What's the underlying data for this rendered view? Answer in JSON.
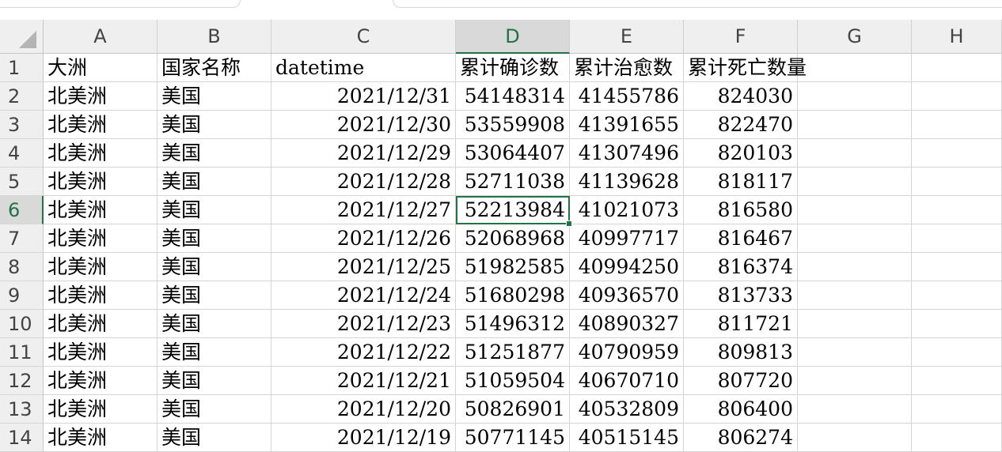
{
  "columns": [
    "A",
    "B",
    "C",
    "D",
    "E",
    "F",
    "G",
    "H"
  ],
  "selected_column": "D",
  "selected_row": "6",
  "header_row": {
    "row_number": "1",
    "cells": [
      "大洲",
      "国家名称",
      "datetime",
      "累计确诊数",
      "累计治愈数",
      "累计死亡数量"
    ]
  },
  "rows": [
    {
      "n": "2",
      "continent": "北美洲",
      "country": "美国",
      "date": "2021/12/31",
      "confirmed": "54148314",
      "recovered": "41455786",
      "deaths": "824030"
    },
    {
      "n": "3",
      "continent": "北美洲",
      "country": "美国",
      "date": "2021/12/30",
      "confirmed": "53559908",
      "recovered": "41391655",
      "deaths": "822470"
    },
    {
      "n": "4",
      "continent": "北美洲",
      "country": "美国",
      "date": "2021/12/29",
      "confirmed": "53064407",
      "recovered": "41307496",
      "deaths": "820103"
    },
    {
      "n": "5",
      "continent": "北美洲",
      "country": "美国",
      "date": "2021/12/28",
      "confirmed": "52711038",
      "recovered": "41139628",
      "deaths": "818117"
    },
    {
      "n": "6",
      "continent": "北美洲",
      "country": "美国",
      "date": "2021/12/27",
      "confirmed": "52213984",
      "recovered": "41021073",
      "deaths": "816580"
    },
    {
      "n": "7",
      "continent": "北美洲",
      "country": "美国",
      "date": "2021/12/26",
      "confirmed": "52068968",
      "recovered": "40997717",
      "deaths": "816467"
    },
    {
      "n": "8",
      "continent": "北美洲",
      "country": "美国",
      "date": "2021/12/25",
      "confirmed": "51982585",
      "recovered": "40994250",
      "deaths": "816374"
    },
    {
      "n": "9",
      "continent": "北美洲",
      "country": "美国",
      "date": "2021/12/24",
      "confirmed": "51680298",
      "recovered": "40936570",
      "deaths": "813733"
    },
    {
      "n": "10",
      "continent": "北美洲",
      "country": "美国",
      "date": "2021/12/23",
      "confirmed": "51496312",
      "recovered": "40890327",
      "deaths": "811721"
    },
    {
      "n": "11",
      "continent": "北美洲",
      "country": "美国",
      "date": "2021/12/22",
      "confirmed": "51251877",
      "recovered": "40790959",
      "deaths": "809813"
    },
    {
      "n": "12",
      "continent": "北美洲",
      "country": "美国",
      "date": "2021/12/21",
      "confirmed": "51059504",
      "recovered": "40670710",
      "deaths": "807720"
    },
    {
      "n": "13",
      "continent": "北美洲",
      "country": "美国",
      "date": "2021/12/20",
      "confirmed": "50826901",
      "recovered": "40532809",
      "deaths": "806400"
    },
    {
      "n": "14",
      "continent": "北美洲",
      "country": "美国",
      "date": "2021/12/19",
      "confirmed": "50771145",
      "recovered": "40515145",
      "deaths": "806274"
    }
  ],
  "colors": {
    "accent": "#217346",
    "header_bg": "#efefef",
    "header_selected_bg": "#d9d9d9",
    "grid": "#d4d4d4"
  }
}
